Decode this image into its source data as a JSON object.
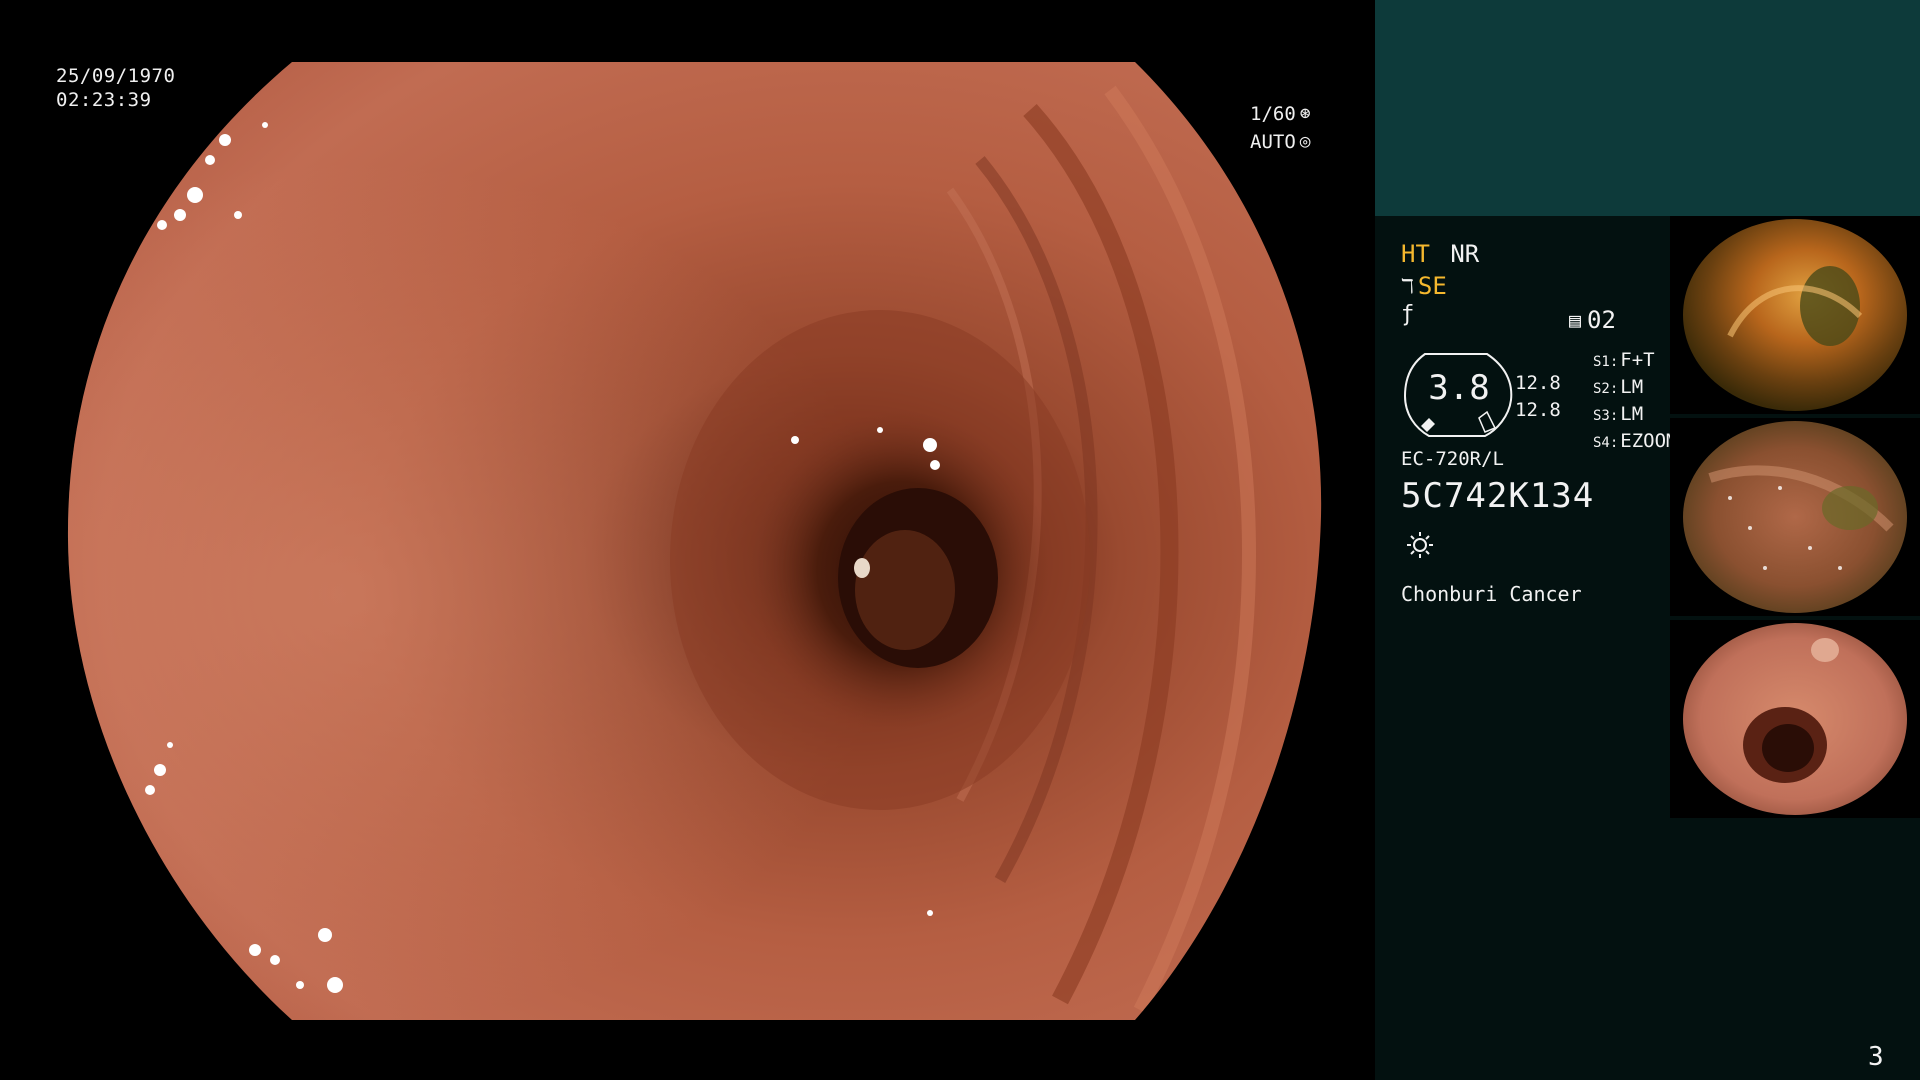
{
  "overlay": {
    "date": "25/09/1970",
    "time": "02:23:39",
    "shutter": "1/60",
    "iris": "AUTO"
  },
  "panel": {
    "mode_ht": "HT",
    "mode_nr": "NR",
    "mode_se": "SE",
    "memo_number": "02",
    "gauge_value": "3.8",
    "val_top": "12.8",
    "val_bottom": "12.8",
    "switches": [
      {
        "label": "S1:",
        "value": "F+T"
      },
      {
        "label": "S2:",
        "value": "LM"
      },
      {
        "label": "S3:",
        "value": "LM"
      },
      {
        "label": "S4:",
        "value": "EZOOM"
      }
    ],
    "scope_model": "EC-720R/L",
    "scope_serial": "5C742K134",
    "hospital": "Chonburi Cancer"
  },
  "page_number": "3",
  "colors": {
    "accent_yellow": "#f5b82e",
    "panel_top": "#0d3a3a",
    "panel_bg": "#031110"
  },
  "icons": {
    "shutter_glyph": "⊛",
    "iris_glyph": "◎",
    "se_glyph": "ℸ",
    "f_glyph": "ƒ",
    "memo_glyph": "▤"
  }
}
